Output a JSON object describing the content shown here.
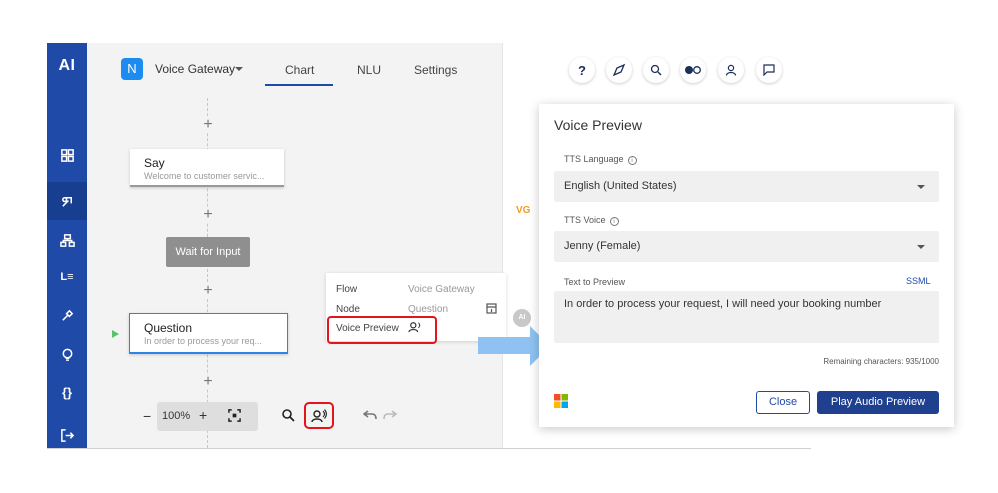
{
  "sidebar": {
    "logo": "AI",
    "items": [
      {
        "icon": "grid-icon"
      },
      {
        "icon": "flow-icon",
        "active": true
      },
      {
        "icon": "org-chart-icon"
      },
      {
        "icon": "list-icon",
        "text": "L≡"
      },
      {
        "icon": "tools-icon"
      },
      {
        "icon": "lightbulb-icon"
      },
      {
        "icon": "code-braces-icon",
        "text": "{}"
      },
      {
        "icon": "logout-icon"
      }
    ]
  },
  "header": {
    "project_initial": "N",
    "project_name": "Voice Gateway",
    "tabs": [
      {
        "label": "Chart",
        "active": true
      },
      {
        "label": "NLU"
      },
      {
        "label": "Settings"
      }
    ],
    "icons": [
      "help-icon",
      "compass-icon",
      "search-icon",
      "toggle-icon",
      "user-icon",
      "chat-icon"
    ],
    "help_text": "?"
  },
  "flow": {
    "say_node": {
      "title": "Say",
      "subtitle": "Welcome to customer servic..."
    },
    "wait_node": {
      "label": "Wait for Input"
    },
    "question_node": {
      "title": "Question",
      "subtitle": "In order to process your req..."
    },
    "plus": "+"
  },
  "zoom": {
    "minus": "−",
    "value": "100%",
    "plus": "+"
  },
  "vg_label": "VG",
  "info_popup": {
    "rows": [
      {
        "label": "Flow",
        "value": "Voice Gateway"
      },
      {
        "label": "Node",
        "value": "Question"
      },
      {
        "label": "Voice Preview",
        "value": ""
      }
    ],
    "ai_badge": "AI"
  },
  "voice_preview": {
    "title": "Voice Preview",
    "tts_language_label": "TTS Language",
    "tts_language_value": "English (United States)",
    "tts_voice_label": "TTS Voice",
    "tts_voice_value": "Jenny (Female)",
    "text_label": "Text to Preview",
    "ssml_link": "SSML",
    "text_value": "In order to process your request, I will need your booking number",
    "remaining": "Remaining characters: 935/1000",
    "close_button": "Close",
    "play_button": "Play Audio Preview",
    "brand_colors": [
      "#f25022",
      "#7fba00",
      "#00a4ef",
      "#ffb900"
    ]
  },
  "colors": {
    "sidebar": "#1f4aa8",
    "accent": "#1f3f8f",
    "highlight": "#e4141d",
    "arrow": "#8fc2f2"
  }
}
